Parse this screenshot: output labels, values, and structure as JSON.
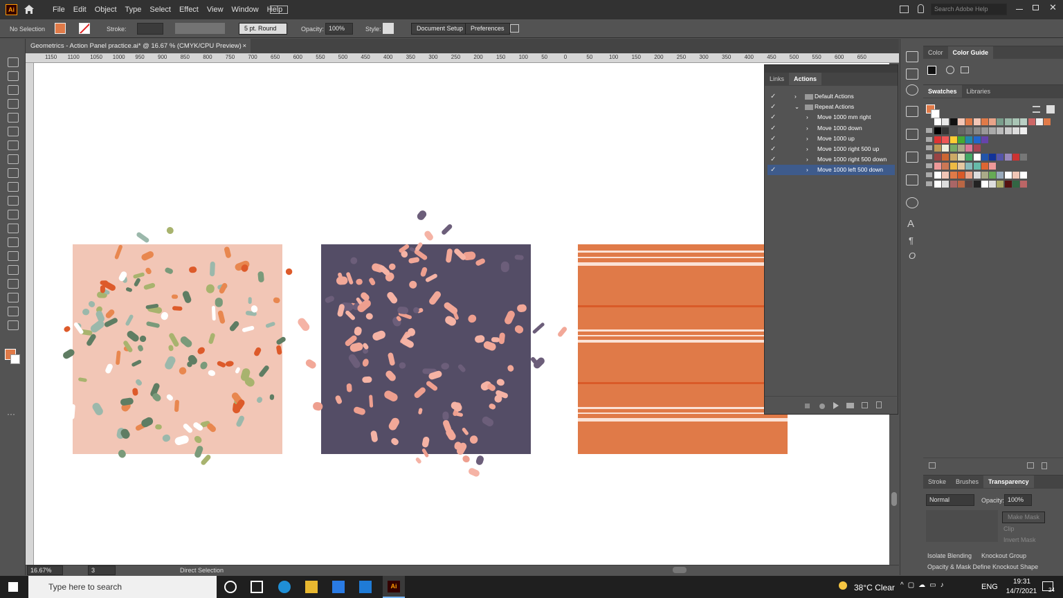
{
  "app": {
    "logo": "Ai",
    "menu": [
      "File",
      "Edit",
      "Object",
      "Type",
      "Select",
      "Effect",
      "View",
      "Window",
      "Help"
    ],
    "search_placeholder": "Search Adobe Help"
  },
  "control": {
    "selection": "No Selection",
    "stroke_label": "Stroke:",
    "brush": "5 pt. Round",
    "opacity_label": "Opacity:",
    "opacity": "100%",
    "style_label": "Style:",
    "doc_setup": "Document Setup",
    "preferences": "Preferences"
  },
  "document": {
    "tab_title": "Geometrics - Action Panel practice.ai* @ 16.67 % (CMYK/CPU Preview)",
    "close": "×"
  },
  "ruler": {
    "ticks": [
      "1150",
      "1100",
      "1050",
      "1000",
      "950",
      "900",
      "850",
      "800",
      "750",
      "700",
      "650",
      "600",
      "550",
      "500",
      "450",
      "400",
      "350",
      "300",
      "250",
      "200",
      "150",
      "100",
      "50",
      "0",
      "50",
      "100",
      "150",
      "200",
      "250",
      "300",
      "350",
      "400",
      "450",
      "500",
      "550",
      "600",
      "650"
    ]
  },
  "status": {
    "zoom": "16.67%",
    "artboard": "3",
    "tool": "Direct Selection"
  },
  "actions_panel": {
    "tabs": [
      "Links",
      "Actions"
    ],
    "rows": [
      {
        "label": "Default Actions",
        "level": 0,
        "folder": true,
        "open": false
      },
      {
        "label": "Repeat Actions",
        "level": 0,
        "folder": true,
        "open": true
      },
      {
        "label": "Move 1000 mm right",
        "level": 1
      },
      {
        "label": "Move 1000 down",
        "level": 1
      },
      {
        "label": "Move 1000 up",
        "level": 1
      },
      {
        "label": "Move 1000 right 500 up",
        "level": 1
      },
      {
        "label": "Move 1000 right 500 down",
        "level": 1
      },
      {
        "label": "Move 1000 left 500 down",
        "level": 1,
        "selected": true
      }
    ]
  },
  "right_panel": {
    "color_tabs": [
      "Color",
      "Color Guide"
    ],
    "swatch_tabs": [
      "Swatches",
      "Libraries"
    ],
    "bottom_tabs": [
      "Stroke",
      "Brushes",
      "Transparency"
    ],
    "blend_mode": "Normal",
    "opacity_label": "Opacity:",
    "opacity": "100%",
    "make_mask": "Make Mask",
    "clip": "Clip",
    "invert_mask": "Invert Mask",
    "isolate": "Isolate Blending",
    "knockout": "Knockout Group",
    "opacity_mask": "Opacity & Mask Define Knockout Shape"
  },
  "colors": {
    "pink_bg": "#f2c6b6",
    "navy_bg": "#544d66",
    "orange_bg": "#e07a48",
    "accent": "#e07a48"
  },
  "taskbar": {
    "search_placeholder": "Type here to search",
    "weather": "38°C  Clear",
    "lang": "ENG",
    "time": "19:31",
    "date": "14/7/2021",
    "notif": "24"
  }
}
